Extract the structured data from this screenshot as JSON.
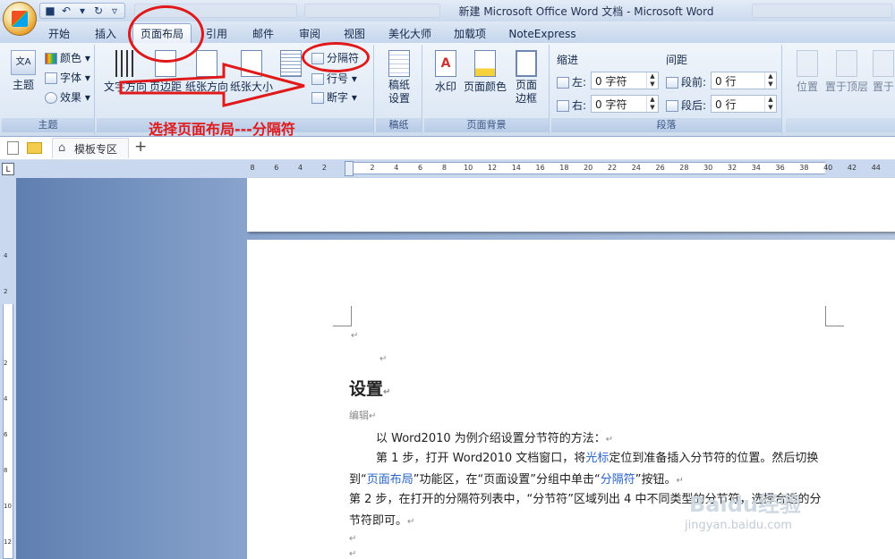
{
  "window": {
    "title": "新建 Microsoft Office Word 文档 - Microsoft Word"
  },
  "tabs": [
    {
      "label": "开始"
    },
    {
      "label": "插入"
    },
    {
      "label": "页面布局"
    },
    {
      "label": "引用"
    },
    {
      "label": "邮件"
    },
    {
      "label": "审阅"
    },
    {
      "label": "视图"
    },
    {
      "label": "美化大师"
    },
    {
      "label": "加载项"
    },
    {
      "label": "NoteExpress"
    }
  ],
  "ribbon": {
    "theme": {
      "label": "主题",
      "theme_btn": "主题",
      "colors": "颜色",
      "fonts": "字体",
      "effects": "效果"
    },
    "page_setup": {
      "text_direction": "文字方向",
      "margins": "页边距",
      "orientation": "纸张方向",
      "size": "纸张大小",
      "breaks": "分隔符",
      "line_numbers": "行号",
      "hyphenation": "断字"
    },
    "draft": {
      "label": "稿纸",
      "btn": "稿纸\n设置"
    },
    "background": {
      "label": "页面背景",
      "watermark": "水印",
      "page_color": "页面颜色",
      "page_border": "页面\n边框"
    },
    "paragraph": {
      "label": "段落",
      "indent": "缩进",
      "spacing": "间距",
      "left_label": "左:",
      "left_val": "0 字符",
      "right_label": "右:",
      "right_val": "0 字符",
      "before_label": "段前:",
      "before_val": "0 行",
      "after_label": "段后:",
      "after_val": "0 行"
    },
    "arrange": {
      "position": "位置",
      "bring_front": "置于顶层",
      "send_back": "置于"
    }
  },
  "docbar": {
    "tab_label": "模板专区",
    "add": "+"
  },
  "annotation": {
    "text": "选择页面布局---分隔符"
  },
  "ruler": {
    "h_ticks": [
      "8",
      "6",
      "4",
      "2",
      "",
      "2",
      "4",
      "6",
      "8",
      "10",
      "12",
      "14",
      "16",
      "18",
      "20",
      "22",
      "24",
      "26",
      "28",
      "30",
      "32",
      "34",
      "36",
      "38",
      "40",
      "42",
      "44"
    ],
    "v_ticks": [
      "4",
      "2",
      "",
      "2",
      "4",
      "6",
      "8",
      "10",
      "12"
    ]
  },
  "document": {
    "heading": "设置",
    "edit": "编辑",
    "p1": "以 Word2010 为例介绍设置分节符的方法：",
    "p2a": "第 1 步，打开 Word2010 文档窗口，将",
    "p2_link": "光标",
    "p2b": "定位到准备插入分节符的位置。然后切换",
    "p3a": "到“",
    "p3_link1": "页面布局",
    "p3b": "”功能区，在“页面设置”分组中单击“",
    "p3_link2": "分隔符",
    "p3c": "”按钮。",
    "p4": "第 2 步，在打开的分隔符列表中，“分节符”区域列出 4 中不同类型的分节符，选择合适的分",
    "p5": "节符即可。",
    "para_mark": "↵"
  },
  "watermark": {
    "brand": "Baidu经验",
    "url": "jingyan.baidu.com"
  }
}
